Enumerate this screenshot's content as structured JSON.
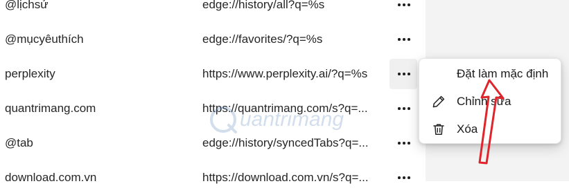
{
  "rows": [
    {
      "name": "@lịchsử",
      "url": "edge://history/all?q=%s"
    },
    {
      "name": "@mụcyêuthích",
      "url": "edge://favorites/?q=%s"
    },
    {
      "name": "perplexity",
      "url": "https://www.perplexity.ai/?q=%s"
    },
    {
      "name": "quantrimang.com",
      "url": "https://quantrimang.com/s?q=..."
    },
    {
      "name": "@tab",
      "url": "edge://history/syncedTabs?q=..."
    },
    {
      "name": "download.com.vn",
      "url": "https://download.com.vn/s?q=..."
    }
  ],
  "context_menu": {
    "items": [
      {
        "label": "Đặt làm mặc định",
        "icon": ""
      },
      {
        "label": "Chỉnh sửa",
        "icon": "pencil-icon"
      },
      {
        "label": "Xóa",
        "icon": "trash-icon"
      }
    ]
  },
  "watermark": {
    "text": "Quantrimang"
  },
  "colors": {
    "annotation_arrow": "#e0242b",
    "right_pane": "#f3f3f3",
    "active_more_button": "#f0f0f0"
  }
}
